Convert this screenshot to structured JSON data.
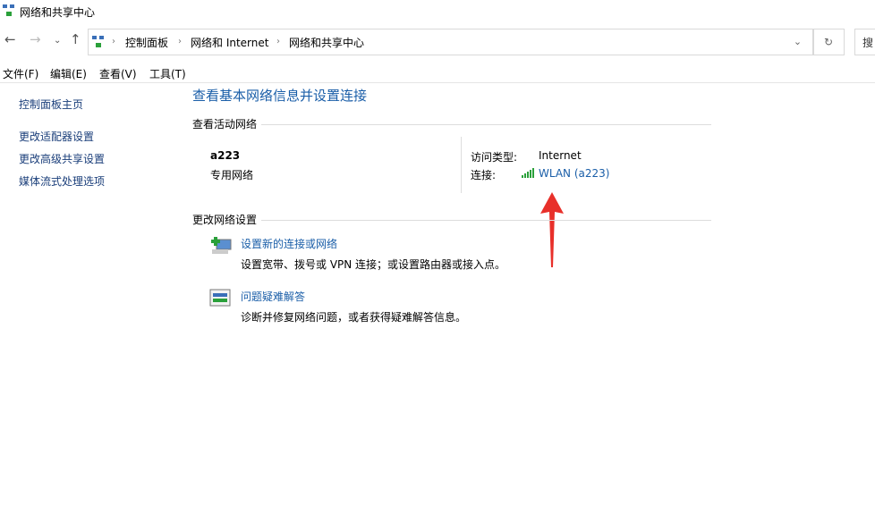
{
  "window": {
    "title": "网络和共享中心"
  },
  "address": {
    "crumbs": [
      "控制面板",
      "网络和 Internet",
      "网络和共享中心"
    ],
    "search_placeholder": "搜"
  },
  "menu": [
    "文件(F)",
    "编辑(E)",
    "查看(V)",
    "工具(T)"
  ],
  "sidebar": {
    "items": [
      "控制面板主页",
      "更改适配器设置",
      "更改高级共享设置",
      "媒体流式处理选项"
    ]
  },
  "main": {
    "title": "查看基本网络信息并设置连接",
    "active_heading": "查看活动网络",
    "network": {
      "name": "a223",
      "type": "专用网络",
      "access_label": "访问类型:",
      "access_value": "Internet",
      "conn_label": "连接:",
      "conn_value": "WLAN (a223)"
    },
    "change_heading": "更改网络设置",
    "tasks": [
      {
        "title": "设置新的连接或网络",
        "desc": "设置宽带、拨号或 VPN 连接；或设置路由器或接入点。"
      },
      {
        "title": "问题疑难解答",
        "desc": "诊断并修复网络问题，或者获得疑难解答信息。"
      }
    ]
  },
  "colors": {
    "link": "#1a5ea8",
    "arrow": "#e8302a",
    "signal": "#2aa03a"
  }
}
